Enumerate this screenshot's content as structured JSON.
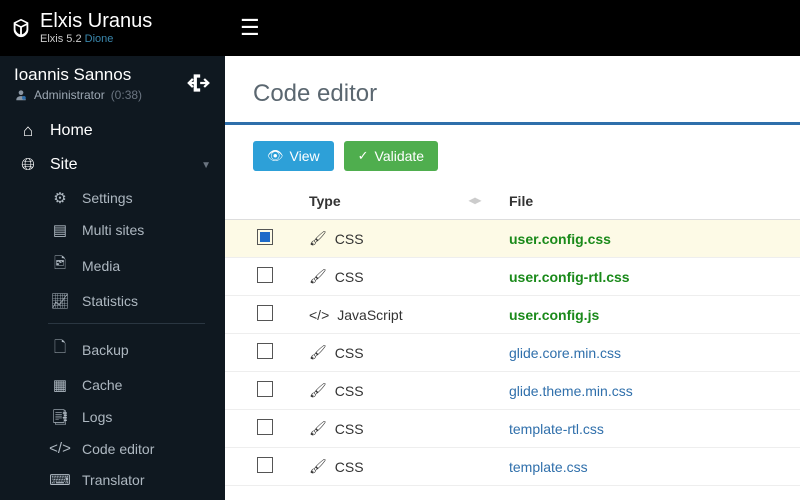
{
  "header": {
    "brand": "Elxis Uranus",
    "version_prefix": "Elxis 5.2",
    "version_link": "Dione"
  },
  "user": {
    "name": "Ioannis Sannos",
    "role": "Administrator",
    "session": "(0:38)"
  },
  "nav": {
    "home": "Home",
    "site": "Site",
    "settings": "Settings",
    "multisites": "Multi sites",
    "media": "Media",
    "statistics": "Statistics",
    "backup": "Backup",
    "cache": "Cache",
    "logs": "Logs",
    "codeeditor": "Code editor",
    "translator": "Translator"
  },
  "page": {
    "title": "Code editor",
    "view": "View",
    "validate": "Validate"
  },
  "table": {
    "col_type": "Type",
    "col_file": "File",
    "rows": [
      {
        "type": "CSS",
        "file": "user.config.css",
        "link": "green",
        "checked": true
      },
      {
        "type": "CSS",
        "file": "user.config-rtl.css",
        "link": "green",
        "checked": false
      },
      {
        "type": "JavaScript",
        "file": "user.config.js",
        "link": "green",
        "checked": false
      },
      {
        "type": "CSS",
        "file": "glide.core.min.css",
        "link": "blue",
        "checked": false
      },
      {
        "type": "CSS",
        "file": "glide.theme.min.css",
        "link": "blue",
        "checked": false
      },
      {
        "type": "CSS",
        "file": "template-rtl.css",
        "link": "blue",
        "checked": false
      },
      {
        "type": "CSS",
        "file": "template.css",
        "link": "blue",
        "checked": false
      }
    ]
  }
}
